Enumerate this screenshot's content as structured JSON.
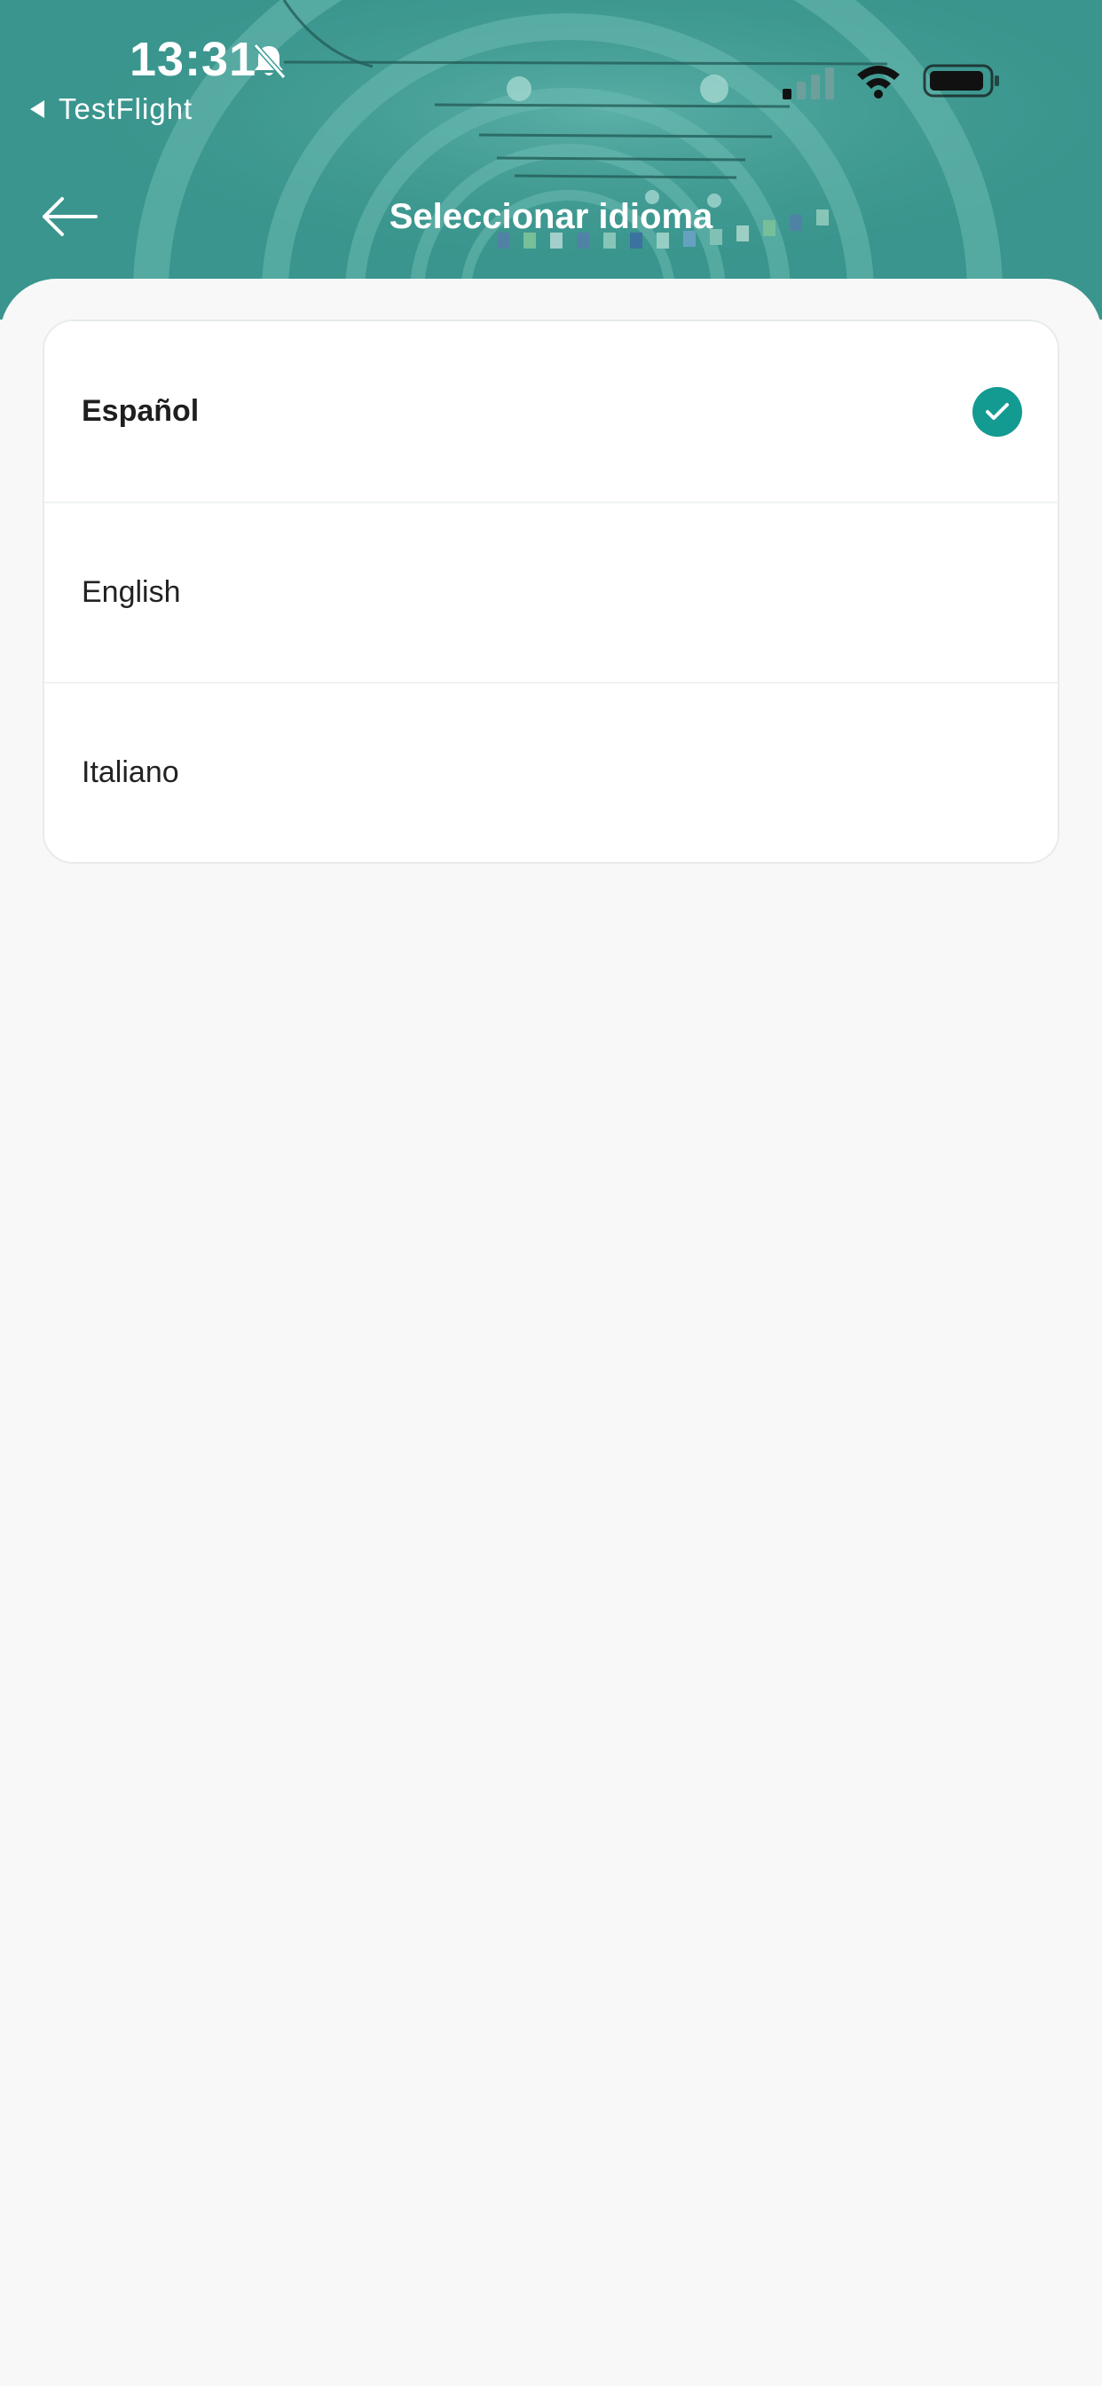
{
  "status_bar": {
    "time": "13:31",
    "back_app": "TestFlight"
  },
  "nav": {
    "title": "Seleccionar idioma"
  },
  "languages": [
    {
      "label": "Español",
      "selected": true
    },
    {
      "label": "English",
      "selected": false
    },
    {
      "label": "Italiano",
      "selected": false
    }
  ],
  "colors": {
    "header_teal": "#3f9e97",
    "accent": "#139a91",
    "background": "#f8f8f8"
  },
  "icons": {
    "back": "arrow-left-icon",
    "selected": "check-icon",
    "silent": "bell-slash-icon"
  }
}
